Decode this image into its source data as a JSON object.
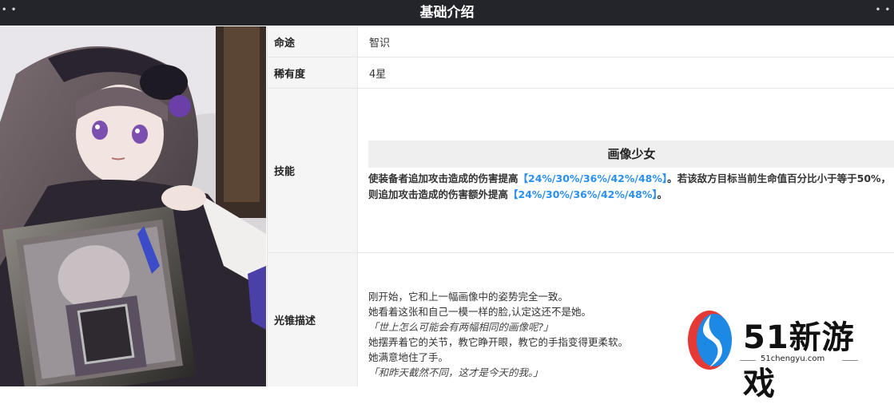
{
  "header": {
    "title": "基础介绍",
    "dots": "• •"
  },
  "rows": {
    "path": {
      "label": "命途",
      "value": "智识"
    },
    "rarity": {
      "label": "稀有度",
      "value": "4星"
    },
    "skill": {
      "label": "技能",
      "name": "画像少女",
      "desc_part1": "使装备者追加攻击造成的伤害提高",
      "desc_hl1": "【24%/30%/36%/42%/48%】",
      "desc_part2": "。若该敌方目标当前生命值百分比小于等于50%，则追加攻击造成的伤害额外提高",
      "desc_hl2": "【24%/30%/36%/42%/48%】",
      "desc_part3": "。"
    },
    "lore": {
      "label": "光锥描述",
      "lines": [
        "刚开始，它和上一幅画像中的姿势完全一致。",
        "她看着这张和自己一模一样的脸,认定这还不是她。",
        "「世上怎么可能会有两幅相同的画像呢?」",
        "她摆弄着它的关节，教它睁开眼，教它的手指变得更柔软。",
        "她满意地住了手。",
        "「和昨天截然不同，这才是今天的我。」"
      ]
    }
  },
  "watermark": {
    "logo_text": "51新游戏",
    "url": "51chengyu.com"
  },
  "colors": {
    "header_bg": "#23252b",
    "highlight": "#2a8ff0",
    "label_bg": "#f5f5f5"
  }
}
